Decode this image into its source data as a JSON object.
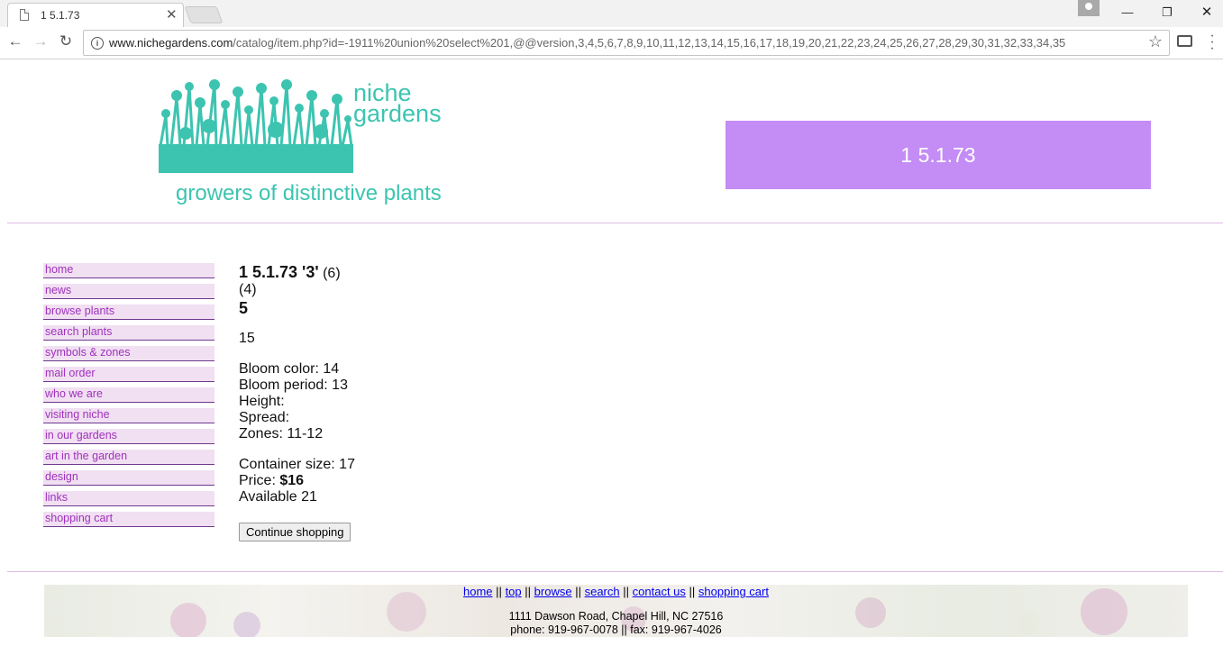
{
  "browser": {
    "tab_title": "1 5.1.73",
    "url_host": "www.nichegardens.com",
    "url_path": "/catalog/item.php?id=-1911%20union%20select%201,@@version,3,4,5,6,7,8,9,10,11,12,13,14,15,16,17,18,19,20,21,22,23,24,25,26,27,28,29,30,31,32,33,34,35"
  },
  "site": {
    "logo_line1": "niche",
    "logo_line2": "gardens",
    "tagline": "growers of distinctive plants",
    "page_heading": "1 5.1.73",
    "brand_color": "#3cc4b0",
    "accent_color": "#c48cf5"
  },
  "sidebar": {
    "items": [
      {
        "label": "home"
      },
      {
        "label": "news"
      },
      {
        "label": "browse plants"
      },
      {
        "label": "search plants"
      },
      {
        "label": "symbols & zones"
      },
      {
        "label": "mail order"
      },
      {
        "label": "who we are"
      },
      {
        "label": "visiting niche"
      },
      {
        "label": "in our gardens"
      },
      {
        "label": "art in the garden"
      },
      {
        "label": "design"
      },
      {
        "label": "links"
      },
      {
        "label": "shopping cart"
      }
    ]
  },
  "item": {
    "name": "1 5.1.73 '3'",
    "paren1": "(6)",
    "paren2": "(4)",
    "number": "5",
    "description": "15",
    "bloom_color": "Bloom color: 14",
    "bloom_period": "Bloom period: 13",
    "height": "Height:",
    "spread": "Spread:",
    "zones": "Zones: 11-12",
    "container": "Container size: 17",
    "price_label": "Price:",
    "price_value": "$16",
    "available": "Available 21",
    "continue_label": "Continue shopping"
  },
  "footer": {
    "links": [
      "home",
      "top",
      "browse",
      "search",
      "contact us",
      "shopping cart"
    ],
    "separator": "||",
    "address": "1111 Dawson Road, Chapel Hill, NC 27516",
    "phone_fax": "phone: 919-967-0078 || fax: 919-967-4026"
  }
}
